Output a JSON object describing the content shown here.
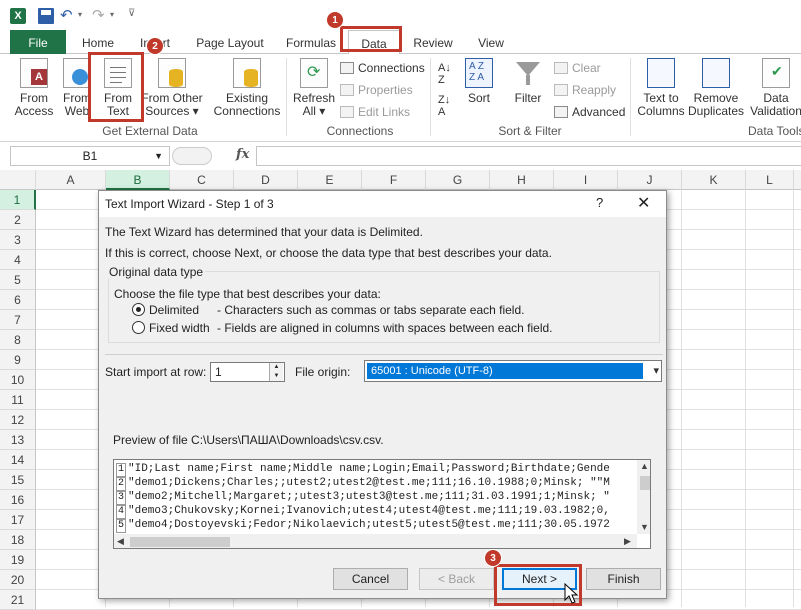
{
  "quick_access": {
    "logo": "X",
    "icons": [
      "excel-logo-icon",
      "save-icon",
      "undo-icon",
      "redo-icon",
      "customize-icon"
    ]
  },
  "tabs": [
    {
      "label": "File"
    },
    {
      "label": "Home"
    },
    {
      "label": "Insert"
    },
    {
      "label": "Page Layout"
    },
    {
      "label": "Formulas"
    },
    {
      "label": "Data"
    },
    {
      "label": "Review"
    },
    {
      "label": "View"
    }
  ],
  "ribbon": {
    "get_external_data": {
      "label": "Get External Data",
      "buttons": [
        {
          "line1": "From",
          "line2": "Access"
        },
        {
          "line1": "From",
          "line2": "Web"
        },
        {
          "line1": "From",
          "line2": "Text"
        },
        {
          "line1": "From Other",
          "line2": "Sources ▾"
        },
        {
          "line1": "Existing",
          "line2": "Connections"
        }
      ]
    },
    "connections": {
      "label": "Connections",
      "refresh_line1": "Refresh",
      "refresh_line2": "All ▾",
      "connections": "Connections",
      "properties": "Properties",
      "edit_links": "Edit Links"
    },
    "sort_filter": {
      "label": "Sort & Filter",
      "sort": "Sort",
      "filter": "Filter",
      "clear": "Clear",
      "reapply": "Reapply",
      "advanced": "Advanced"
    },
    "data_tools": {
      "label": "Data Tools",
      "text_to_columns_1": "Text to",
      "text_to_columns_2": "Columns",
      "remove_duplicates_1": "Remove",
      "remove_duplicates_2": "Duplicates",
      "data_validation_1": "Data",
      "data_validation_2": "Validation"
    }
  },
  "formula_bar": {
    "name_box": "B1",
    "fx": "fx",
    "value": ""
  },
  "grid": {
    "columns": [
      "A",
      "B",
      "C",
      "D",
      "E",
      "F",
      "G",
      "H",
      "I",
      "J",
      "K",
      "L"
    ],
    "rows": [
      "1",
      "2",
      "3",
      "4",
      "5",
      "6",
      "7",
      "8",
      "9",
      "10",
      "11",
      "12",
      "13",
      "14",
      "15",
      "16",
      "17",
      "18",
      "19",
      "20",
      "21"
    ],
    "selected_cell": "B1"
  },
  "dialog": {
    "title": "Text Import Wizard - Step 1 of 3",
    "help": "?",
    "close": "✕",
    "line1": "The Text Wizard has determined that your data is Delimited.",
    "line2": "If this is correct, choose Next, or choose the data type that best describes your data.",
    "group_title": "Original data type",
    "choose_text": "Choose the file type that best describes your data:",
    "option_delimited": "Delimited",
    "option_delimited_desc": "- Characters such as commas or tabs separate each field.",
    "option_fixed": "Fixed width",
    "option_fixed_desc": "- Fields are aligned in columns with spaces between each field.",
    "selected_option": "Delimited",
    "start_row_label": "Start import at row:",
    "start_row_value": "1",
    "file_origin_label": "File origin:",
    "file_origin_value": "65001 : Unicode (UTF-8)",
    "preview_label": "Preview of file C:\\Users\\ПАША\\Downloads\\csv.csv.",
    "preview_lines": [
      {
        "n": "1",
        "text": "\"ID;Last name;First name;Middle name;Login;Email;Password;Birthdate;Gende"
      },
      {
        "n": "2",
        "text": "\"demo1;Dickens;Charles;;utest2;utest2@test.me;111;16.10.1988;0;Minsk; \"\"M"
      },
      {
        "n": "3",
        "text": "\"demo2;Mitchell;Margaret;;utest3;utest3@test.me;111;31.03.1991;1;Minsk; \""
      },
      {
        "n": "4",
        "text": "\"demo3;Chukovsky;Kornei;Ivanovich;utest4;utest4@test.me;111;19.03.1982;0,"
      },
      {
        "n": "5",
        "text": "\"demo4;Dostoyevski;Fedor;Nikolaevich;utest5;utest5@test.me;111;30.05.1972"
      }
    ],
    "buttons": {
      "cancel": "Cancel",
      "back": "< Back",
      "next": "Next >",
      "finish": "Finish"
    }
  },
  "callouts": [
    {
      "number": "1",
      "target": "Data tab"
    },
    {
      "number": "2",
      "target": "From Text"
    },
    {
      "number": "3",
      "target": "Next >"
    }
  ],
  "colors": {
    "excel_green": "#217346",
    "callout_red": "#c0392b",
    "selection_blue": "#0078d7"
  }
}
